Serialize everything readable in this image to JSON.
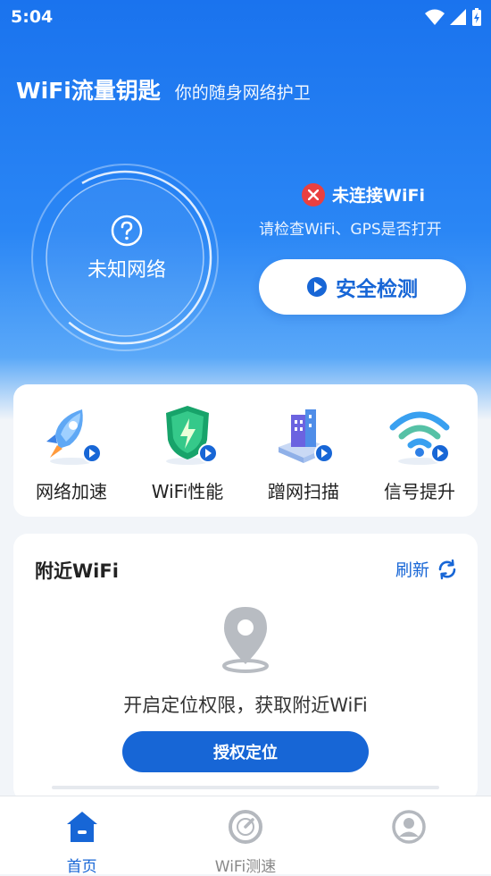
{
  "status_bar": {
    "time": "5:04"
  },
  "header": {
    "app_title": "WiFi流量钥匙",
    "subtitle": "你的随身网络护卫"
  },
  "gauge": {
    "state_label": "未知网络",
    "icon": "question-icon"
  },
  "connection": {
    "status": "未连接WiFi",
    "hint": "请检查WiFi、GPS是否打开",
    "check_button": "安全检测"
  },
  "tools": [
    {
      "label": "网络加速",
      "icon": "rocket-icon"
    },
    {
      "label": "WiFi性能",
      "icon": "shield-bolt-icon"
    },
    {
      "label": "蹭网扫描",
      "icon": "building-scan-icon"
    },
    {
      "label": "信号提升",
      "icon": "wifi-signal-icon"
    }
  ],
  "nearby": {
    "title": "附近WiFi",
    "refresh_label": "刷新",
    "location_prompt": "开启定位权限，获取附近WiFi",
    "auth_button": "授权定位"
  },
  "bottom_nav": [
    {
      "label": "首页",
      "icon": "home-icon",
      "active": true
    },
    {
      "label": "WiFi测速",
      "icon": "speedometer-icon",
      "active": false
    },
    {
      "label": "",
      "icon": "profile-icon",
      "active": false
    }
  ],
  "colors": {
    "primary": "#1766d6",
    "hero_top": "#1a73ee",
    "error": "#e94040"
  }
}
